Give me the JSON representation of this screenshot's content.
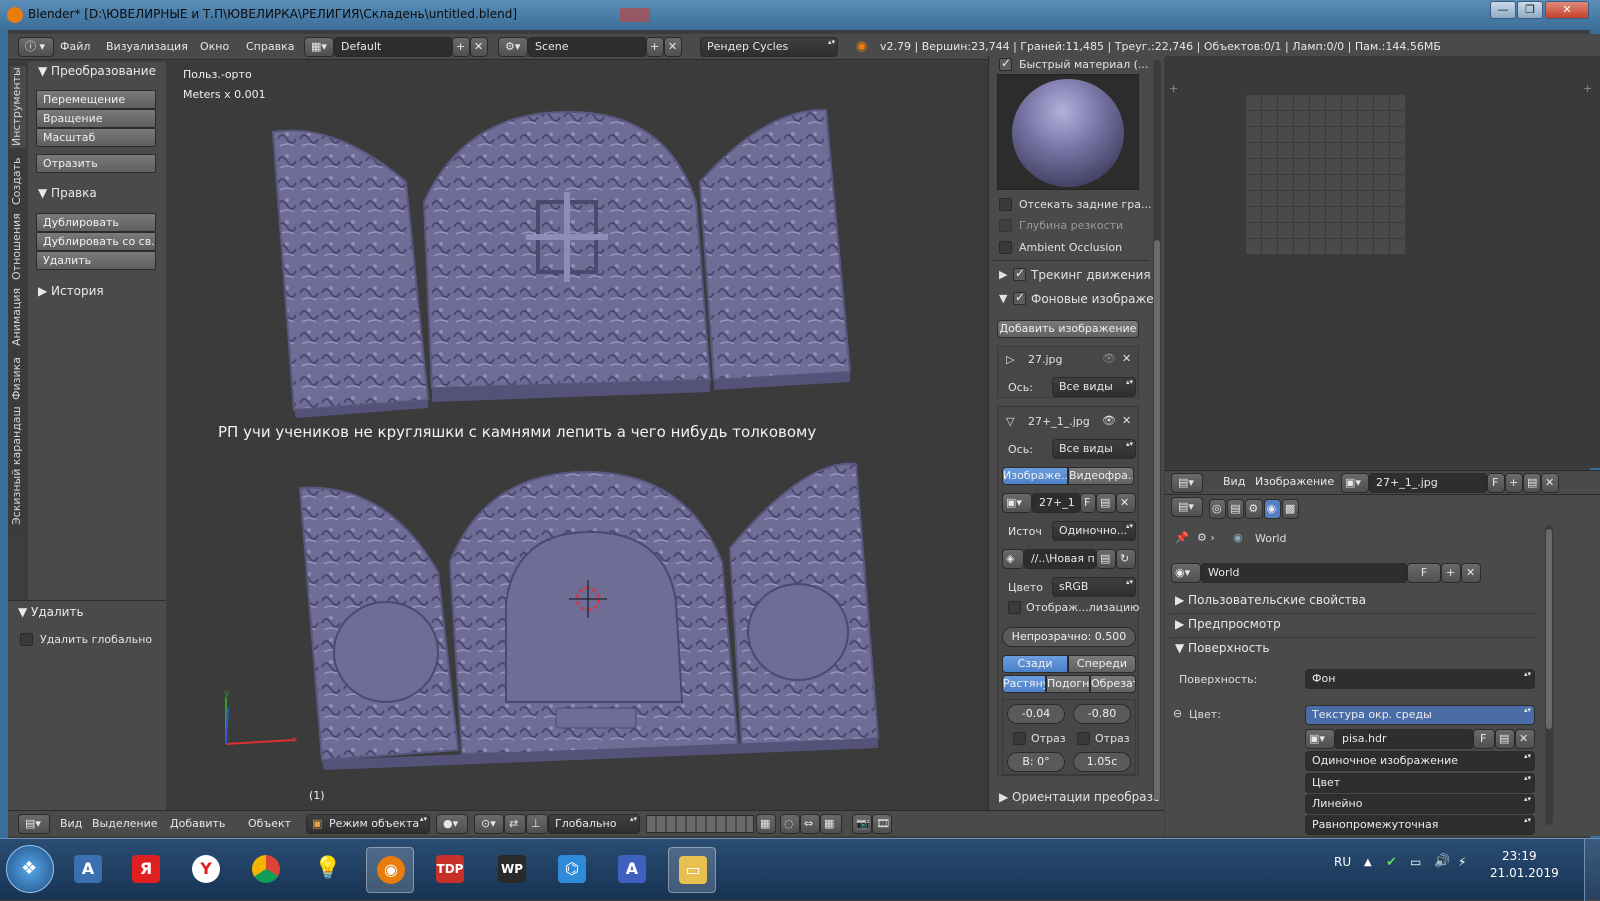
{
  "window": {
    "title": "Blender* [D:\\ЮВЕЛИРНЫЕ и Т.П\\ЮВЕЛИРКА\\РЕЛИГИЯ\\Складень\\untitled.blend]",
    "minimize": "—",
    "maximize": "❐",
    "close": "✕"
  },
  "info_header": {
    "menus": [
      "Файл",
      "Визуализация",
      "Окно",
      "Справка"
    ],
    "layout": "Default",
    "scene": "Scene",
    "engine": "Рендер Cycles",
    "stats": "v2.79 | Вершин:23,744 | Граней:11,485 | Треуг.:22,746 | Объектов:0/1 | Ламп:0/0 | Пам.:144.56МБ"
  },
  "left_tabs": [
    "Инструменты",
    "Создать",
    "Отношения",
    "Анимация",
    "Физика",
    "Эскизный карандаш"
  ],
  "toolshelf": {
    "transform_header": "Преобразование",
    "transform_buttons": [
      "Перемещение",
      "Вращение",
      "Масштаб"
    ],
    "mirror": "Отразить",
    "edit_header": "Правка",
    "edit_buttons": [
      "Дублировать",
      "Дублировать со св...",
      "Удалить"
    ],
    "history_header": "История"
  },
  "operator": {
    "header": "Удалить",
    "checkbox_label": "Удалить глобально"
  },
  "viewport": {
    "view_name": "Польз.-орто",
    "units": "Meters x 0.001",
    "annotation": "РП учи учеников не кругляшки с камнями лепить а чего нибудь толковому",
    "frame": "(1)"
  },
  "npanel": {
    "quick_material": "Быстрый материал (...",
    "backface": "Отсекать задние гра...",
    "dof": "Глубина резкости",
    "ao": "Ambient Occlusion",
    "motion_tracking": "Трекинг движения",
    "bg_images": "Фоновые изображен",
    "add_image": "Добавить изображение",
    "img1_name": "27.jpg",
    "axis_label": "Ось:",
    "axis_value": "Все виды",
    "img2_name": "27+_1_.jpg",
    "tab_image": "Изображе...",
    "tab_movie": "Видеофра...",
    "img_field": "27+_1",
    "f_label": "F",
    "source_label": "Источ",
    "source_value": "Одиночно...",
    "filepath": "//..\\Новая п...",
    "color_label": "Цвето",
    "color_value": "sRGB",
    "display_label": "Отображ...лизацию",
    "opacity": "Непрозрачно: 0.500",
    "back": "Сзади",
    "front": "Спереди",
    "stretch": "Растяну",
    "fit": "Подогна",
    "crop": "Обрезат",
    "x_offset": "-0.04",
    "y_offset": "-0.80",
    "flip_x": "Отраз",
    "flip_y": "Отраз",
    "rotation": "В: 0°",
    "scale": "1.05с",
    "transform_orient": "Ориентации преобразо"
  },
  "image_editor_header": {
    "menus": [
      "Вид",
      "Изображение"
    ],
    "image_name": "27+_1_.jpg",
    "f_label": "F"
  },
  "properties": {
    "world_breadcrumb": "World",
    "world_field": "World",
    "f_label": "F",
    "custom_props": "Пользовательские свойства",
    "preview": "Предпросмотр",
    "surface_header": "Поверхность",
    "surface_label": "Поверхность:",
    "surface_value": "Фон",
    "color_label": "Цвет:",
    "color_value": "Текстура окр. среды",
    "hdr_name": "pisa.hdr",
    "single_image": "Одиночное изображение",
    "color_mode": "Цвет",
    "interp": "Линейно",
    "projection": "Равнопромежуточная"
  },
  "v3d_header": {
    "menus": [
      "Вид",
      "Выделение",
      "Добавить",
      "Объект"
    ],
    "mode": "Режим объекта",
    "orientation": "Глобально"
  },
  "taskbar": {
    "lang": "RU",
    "time": "23:19",
    "date": "21.01.2019"
  },
  "colors": {
    "model": "#6f6c96",
    "accent_blue": "#5680c2",
    "panel": "#4a4a4a"
  }
}
